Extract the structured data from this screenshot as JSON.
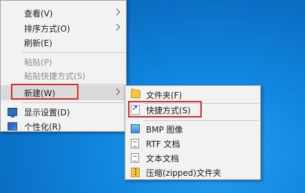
{
  "context_menu": {
    "items": [
      {
        "label": "查看(V)"
      },
      {
        "label": "排序方式(O)"
      },
      {
        "label": "刷新(E)"
      },
      {
        "label": "粘贴(P)"
      },
      {
        "label": "粘贴快捷方式(S)"
      },
      {
        "label": "新建(W)"
      },
      {
        "label": "显示设置(D)",
        "icon": "display-settings-icon"
      },
      {
        "label": "个性化(R)",
        "icon": "personalize-icon"
      }
    ]
  },
  "new_submenu": {
    "items": [
      {
        "label": "文件夹(F)",
        "icon": "folder-icon"
      },
      {
        "label": "快捷方式(S)",
        "icon": "shortcut-icon"
      },
      {
        "label": "BMP 图像",
        "icon": "bitmap-image-icon"
      },
      {
        "label": "RTF 文档",
        "icon": "rtf-document-icon"
      },
      {
        "label": "文本文档",
        "icon": "text-document-icon"
      },
      {
        "label": "压缩(zipped)文件夹",
        "icon": "zip-folder-icon"
      }
    ]
  },
  "colors": {
    "highlight_box": "#e0242c",
    "menu_background": "#f2f2f2",
    "desktop_blue": "#0a86d8"
  }
}
